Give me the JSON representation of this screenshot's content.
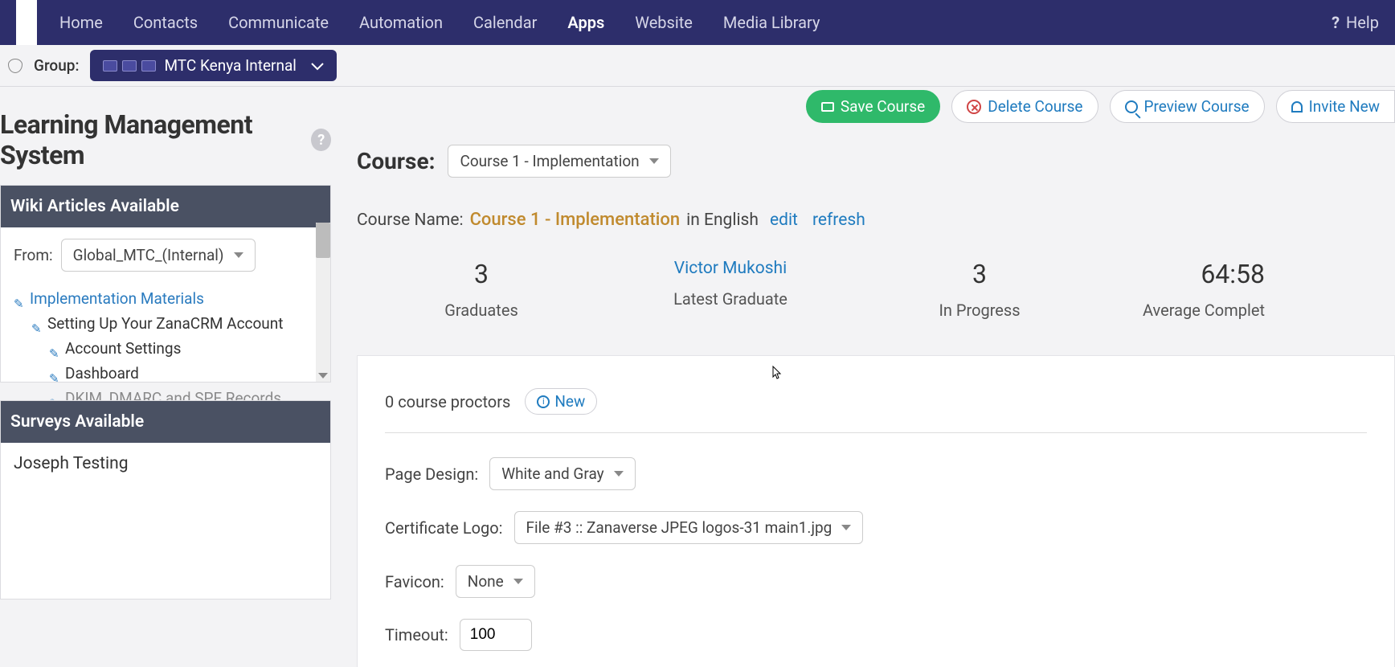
{
  "nav": {
    "items": [
      "Home",
      "Contacts",
      "Communicate",
      "Automation",
      "Calendar",
      "Apps",
      "Website",
      "Media Library"
    ],
    "active": "Apps",
    "help": "Help"
  },
  "subbar": {
    "group_label": "Group:",
    "group_value": "MTC Kenya Internal"
  },
  "page": {
    "title": "Learning Management System"
  },
  "actions": {
    "save": "Save Course",
    "delete": "Delete Course",
    "preview": "Preview Course",
    "invite": "Invite New"
  },
  "wiki": {
    "title": "Wiki Articles Available",
    "from_label": "From:",
    "from_value": "Global_MTC_(Internal)",
    "tree": {
      "root": "Implementation Materials",
      "l1": "Setting Up Your ZanaCRM Account",
      "l2a": "Account Settings",
      "l2b": "Dashboard",
      "l2c": "DKIM, DMARC and SPF Records"
    }
  },
  "surveys": {
    "title": "Surveys Available",
    "item": "Joseph Testing"
  },
  "course": {
    "label": "Course:",
    "selected": "Course 1 - Implementation",
    "name_label": "Course Name:",
    "name_value": "Course 1 - Implementation",
    "lang_text": "in English",
    "edit": "edit",
    "refresh": "refresh"
  },
  "stats": {
    "graduates_num": "3",
    "graduates_label": "Graduates",
    "latest_name": "Victor Mukoshi",
    "latest_label": "Latest Graduate",
    "inprogress_num": "3",
    "inprogress_label": "In Progress",
    "avg_num": "64:58",
    "avg_label": "Average Complet"
  },
  "config": {
    "proctors_text": "0 course proctors",
    "new_label": "New",
    "page_design_label": "Page Design:",
    "page_design_value": "White and Gray",
    "cert_logo_label": "Certificate Logo:",
    "cert_logo_value": "File #3 :: Zanaverse JPEG logos-31 main1.jpg",
    "favicon_label": "Favicon:",
    "favicon_value": "None",
    "timeout_label": "Timeout:",
    "timeout_value": "100"
  }
}
